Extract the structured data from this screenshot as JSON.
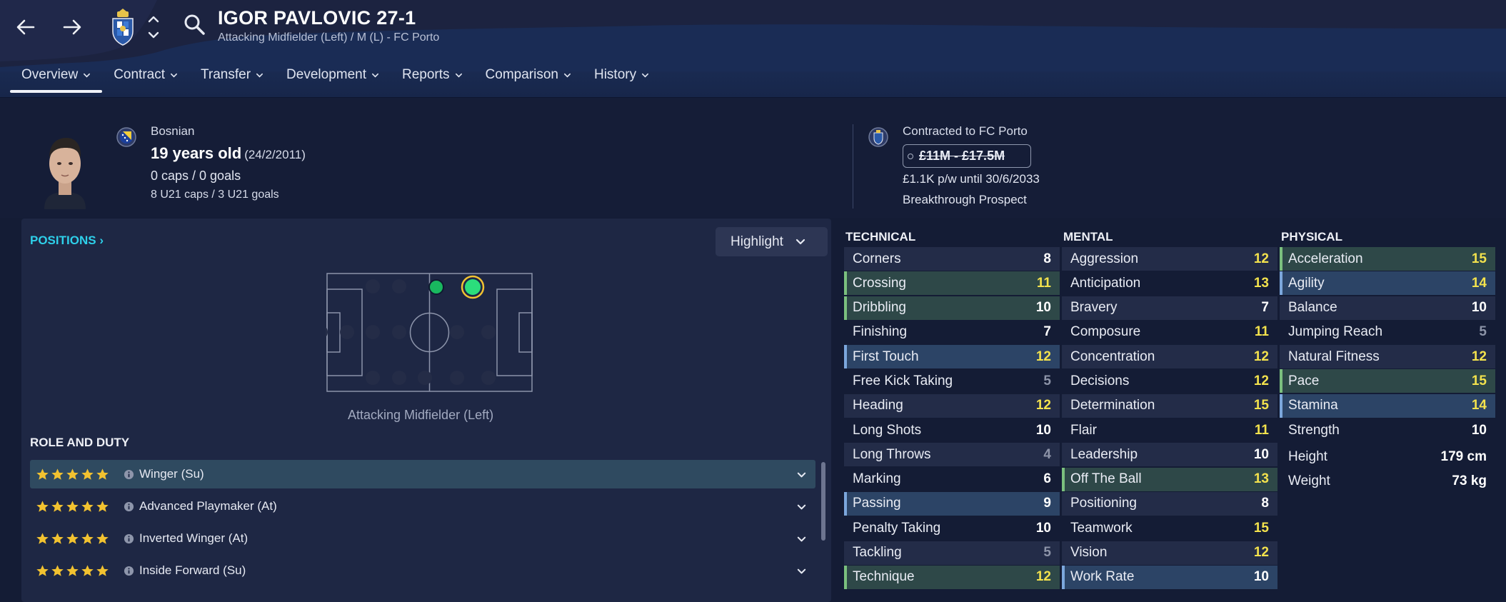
{
  "header": {
    "name": "IGOR PAVLOVIC 27-1",
    "subtitle": "Attacking Midfielder (Left) / M (L) - FC Porto",
    "tabs": [
      "Overview",
      "Contract",
      "Transfer",
      "Development",
      "Reports",
      "Comparison",
      "History"
    ],
    "active_tab": "Overview"
  },
  "profile": {
    "nationality": "Bosnian",
    "age": "19 years old",
    "dob": "(24/2/2011)",
    "caps": "0 caps / 0 goals",
    "u21": "8 U21 caps / 3 U21 goals",
    "contracted": "Contracted to FC Porto",
    "value": "£11M - £17.5M",
    "wage": "£1.1K p/w until 30/6/2033",
    "status": "Breakthrough Prospect"
  },
  "positions": {
    "link": "POSITIONS",
    "highlight": "Highlight",
    "label": "Attacking Midfielder (Left)"
  },
  "roles": {
    "heading": "ROLE AND DUTY",
    "items": [
      {
        "name": "Winger (Su)",
        "stars": 5
      },
      {
        "name": "Advanced Playmaker (At)",
        "stars": 5
      },
      {
        "name": "Inverted Winger (At)",
        "stars": 5
      },
      {
        "name": "Inside Forward (Su)",
        "stars": 5
      }
    ]
  },
  "technical": {
    "heading": "TECHNICAL",
    "items": [
      {
        "name": "Corners",
        "value": "8"
      },
      {
        "name": "Crossing",
        "value": "11"
      },
      {
        "name": "Dribbling",
        "value": "10"
      },
      {
        "name": "Finishing",
        "value": "7"
      },
      {
        "name": "First Touch",
        "value": "12"
      },
      {
        "name": "Free Kick Taking",
        "value": "5"
      },
      {
        "name": "Heading",
        "value": "12"
      },
      {
        "name": "Long Shots",
        "value": "10"
      },
      {
        "name": "Long Throws",
        "value": "4"
      },
      {
        "name": "Marking",
        "value": "6"
      },
      {
        "name": "Passing",
        "value": "9"
      },
      {
        "name": "Penalty Taking",
        "value": "10"
      },
      {
        "name": "Tackling",
        "value": "5"
      },
      {
        "name": "Technique",
        "value": "12"
      }
    ]
  },
  "mental": {
    "heading": "MENTAL",
    "items": [
      {
        "name": "Aggression",
        "value": "12"
      },
      {
        "name": "Anticipation",
        "value": "13"
      },
      {
        "name": "Bravery",
        "value": "7"
      },
      {
        "name": "Composure",
        "value": "11"
      },
      {
        "name": "Concentration",
        "value": "12"
      },
      {
        "name": "Decisions",
        "value": "12"
      },
      {
        "name": "Determination",
        "value": "15"
      },
      {
        "name": "Flair",
        "value": "11"
      },
      {
        "name": "Leadership",
        "value": "10"
      },
      {
        "name": "Off The Ball",
        "value": "13"
      },
      {
        "name": "Positioning",
        "value": "8"
      },
      {
        "name": "Teamwork",
        "value": "15"
      },
      {
        "name": "Vision",
        "value": "12"
      },
      {
        "name": "Work Rate",
        "value": "10"
      }
    ]
  },
  "physical": {
    "heading": "PHYSICAL",
    "items": [
      {
        "name": "Acceleration",
        "value": "15"
      },
      {
        "name": "Agility",
        "value": "14"
      },
      {
        "name": "Balance",
        "value": "10"
      },
      {
        "name": "Jumping Reach",
        "value": "5"
      },
      {
        "name": "Natural Fitness",
        "value": "12"
      },
      {
        "name": "Pace",
        "value": "15"
      },
      {
        "name": "Stamina",
        "value": "14"
      },
      {
        "name": "Strength",
        "value": "10"
      },
      {
        "name": "Height",
        "value": "179 cm"
      },
      {
        "name": "Weight",
        "value": "73 kg"
      }
    ]
  },
  "colors": {
    "accent": "#2ed0ea",
    "high_value": "#f3e24d",
    "star": "#f2c230",
    "position_natural": "#2bde7c",
    "position_ring": "#f1c232"
  }
}
